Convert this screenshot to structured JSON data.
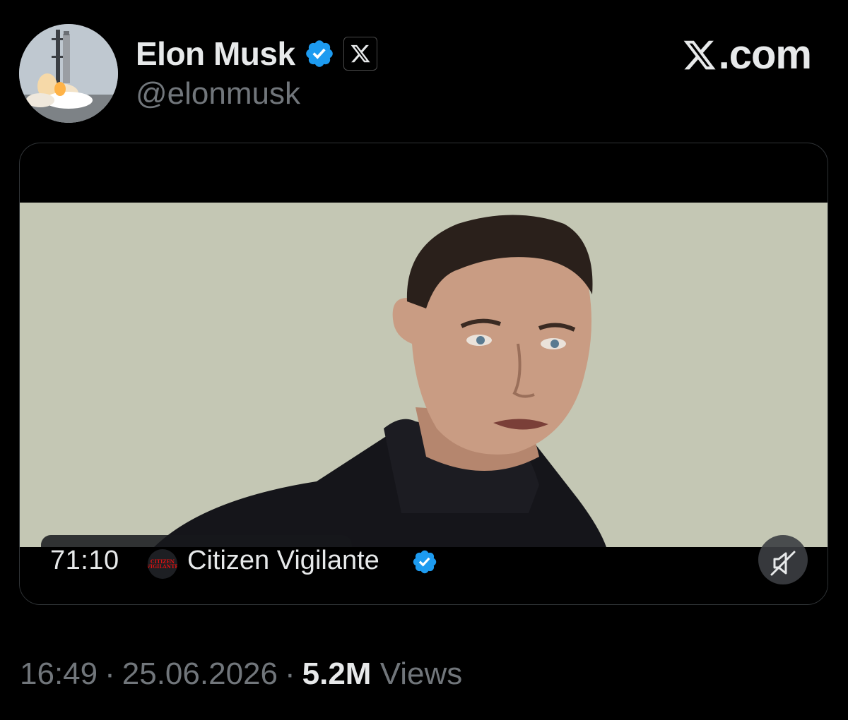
{
  "author": {
    "display_name": "Elon Musk",
    "handle": "@elonmusk",
    "avatar_icon": "starship-launch-avatar",
    "verified_icon": "verified-badge-icon",
    "affiliation_icon": "x-logo-icon"
  },
  "brand": {
    "text": ".com",
    "icon": "x-logo-icon"
  },
  "video": {
    "duration": "71:10",
    "channel_name": "Citizen Vigilante",
    "channel_logo_text": "CITIZEN VIGILANTE",
    "mute_icon": "muted-speaker-icon"
  },
  "meta": {
    "time": "16:49",
    "separator": "·",
    "date": "25.06.2026",
    "views_count": "5.2M",
    "views_label": "Views"
  },
  "colors": {
    "background": "#000000",
    "verified_blue": "#1d9bf0",
    "primary_text": "#e7e9ea",
    "secondary_text": "#71767b"
  }
}
